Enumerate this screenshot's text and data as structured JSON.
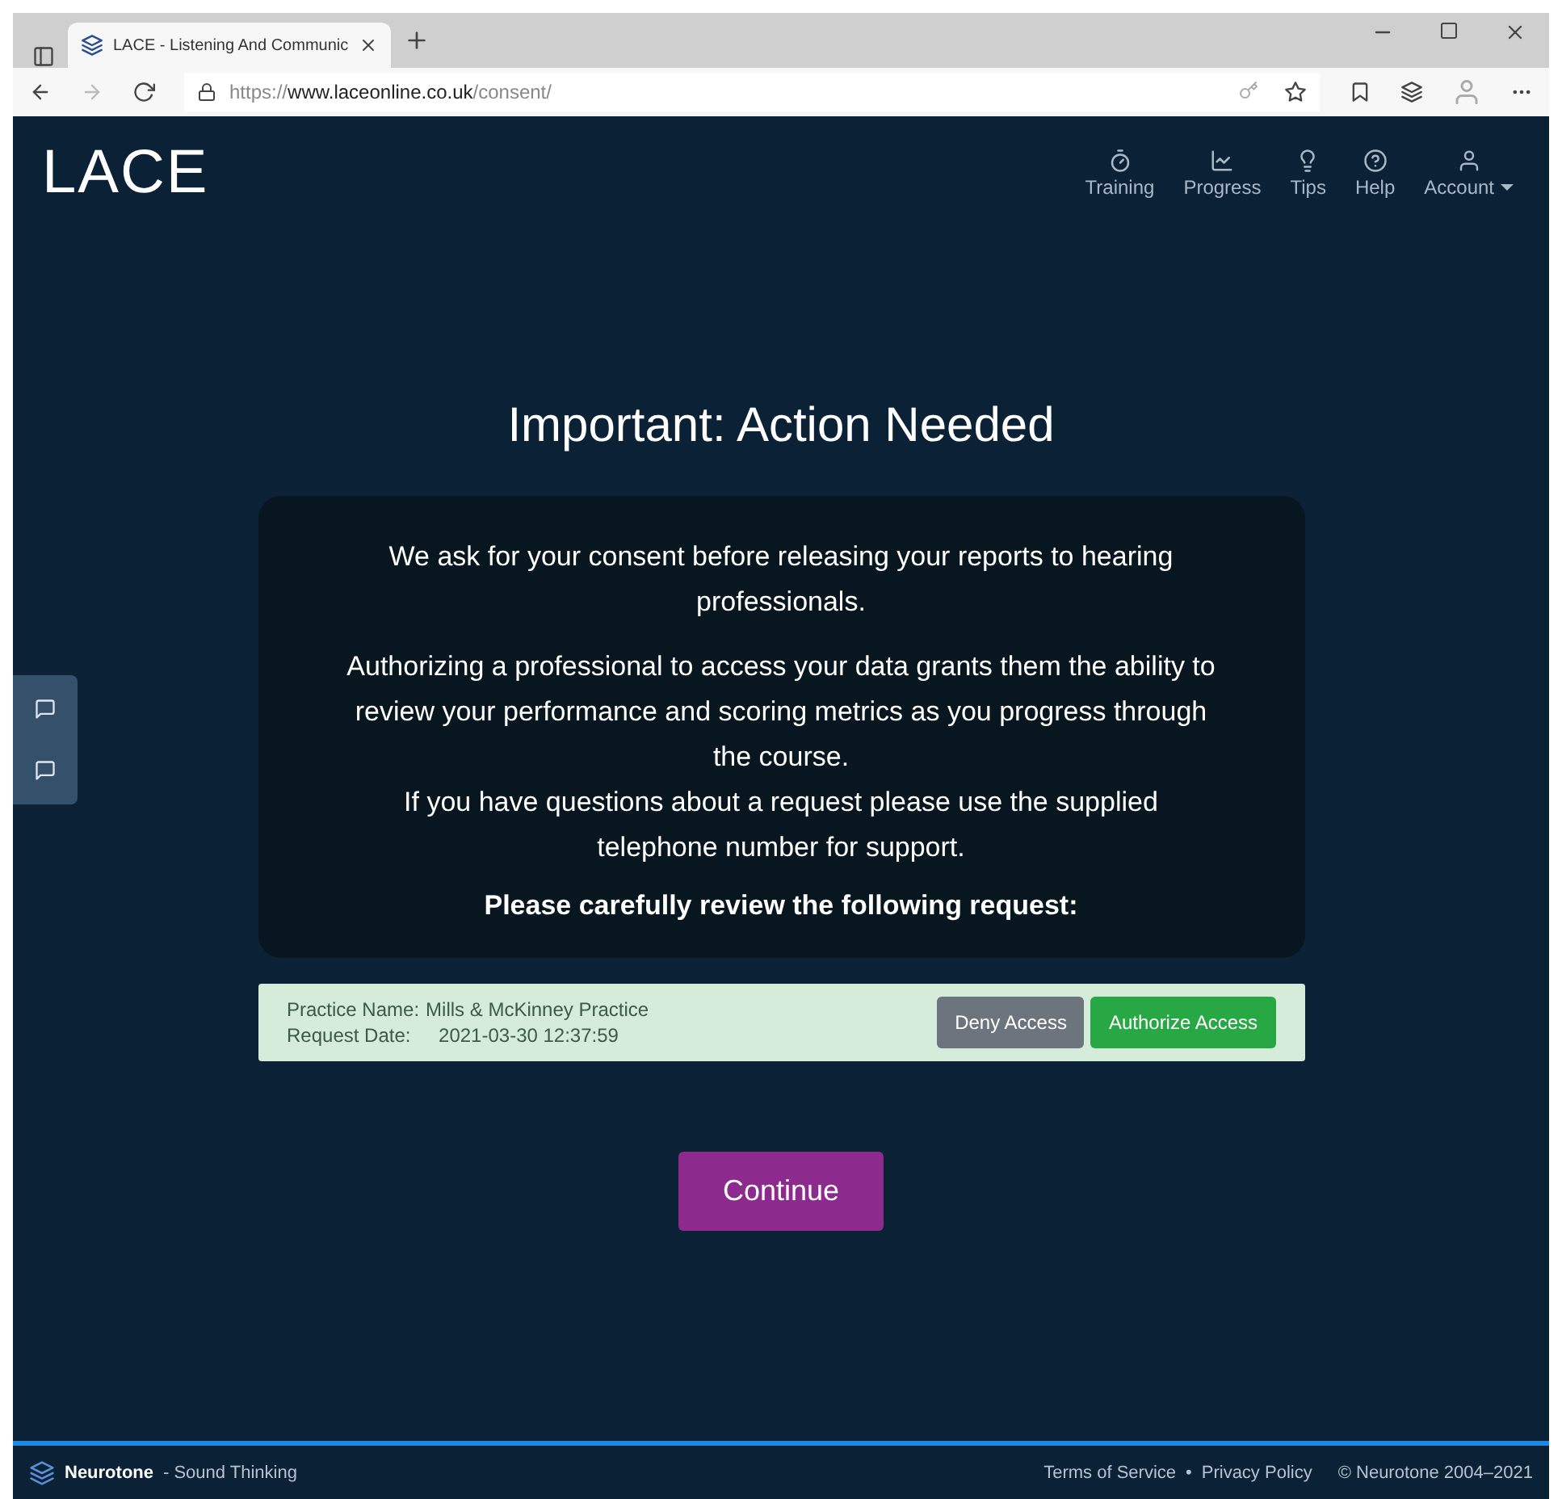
{
  "browser": {
    "tab_title": "LACE - Listening And Communic",
    "url": "https://**www.laceonline.co.uk**/consent/"
  },
  "header": {
    "logo": "LACE",
    "nav": [
      {
        "kind": "timer",
        "label": "Training",
        "dropdown": false
      },
      {
        "kind": "chart",
        "label": "Progress",
        "dropdown": false
      },
      {
        "kind": "bulb",
        "label": "Tips",
        "dropdown": false
      },
      {
        "kind": "help",
        "label": "Help",
        "dropdown": false
      },
      {
        "kind": "user",
        "label": "Account",
        "dropdown": true
      }
    ]
  },
  "title": "Important: Action Needed",
  "notice": {
    "paragraphs": [
      "We ask for your consent before releasing your reports to hearing professionals.",
      "Authorizing a professional to access your data grants them the ability to review your performance and scoring metrics as you progress through the course.\nIf you have questions about a request please use the supplied telephone number for support."
    ],
    "prompt": "Please carefully review the following request:"
  },
  "request": {
    "practice_label": "Practice Name:",
    "practice": "Mills & McKinney Practice",
    "date_label": "Request Date:",
    "date": "2021-03-30 12:37:59",
    "buttons": [
      {
        "kind": "deny",
        "label": "Deny Access"
      },
      {
        "kind": "authorize",
        "label": "Authorize Access"
      }
    ]
  },
  "continue": "Continue",
  "footer": {
    "brand": "Neurotone",
    "tagline": "- Sound Thinking",
    "links": [
      "Terms of Service",
      "Privacy Policy"
    ],
    "separator": "•",
    "copyright": "© Neurotone 2004–2021"
  }
}
